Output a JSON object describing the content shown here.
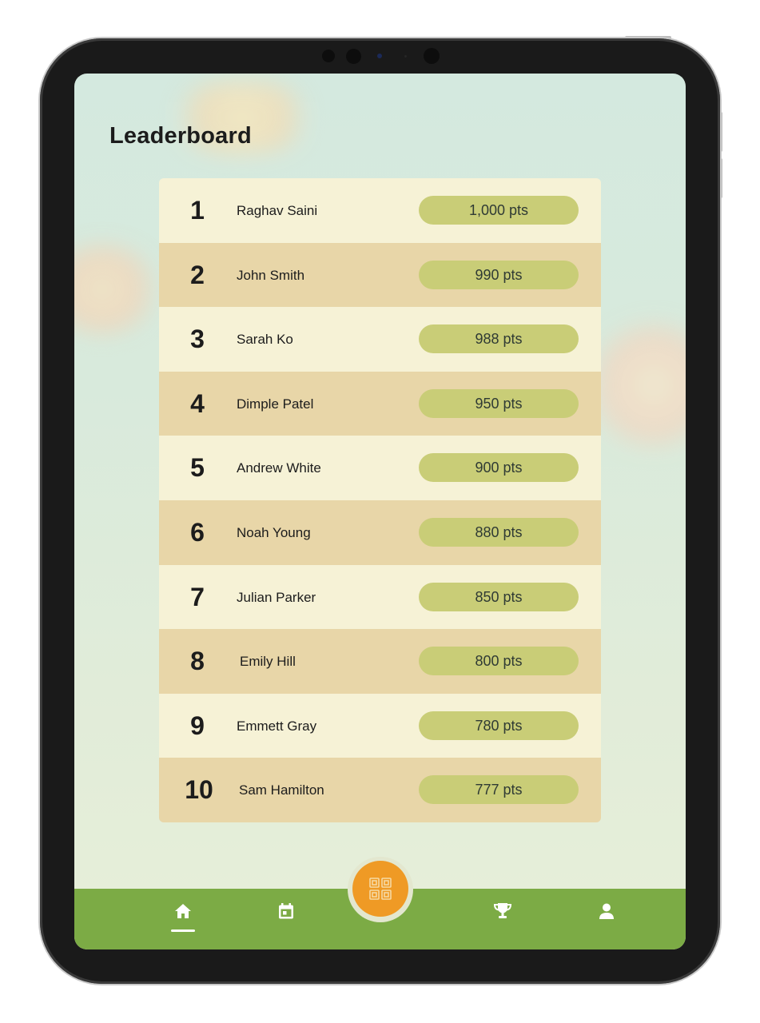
{
  "page": {
    "title": "Leaderboard"
  },
  "leaderboard": [
    {
      "rank": "1",
      "name": "Raghav Saini",
      "points": "1,000 pts"
    },
    {
      "rank": "2",
      "name": "John Smith",
      "points": "990 pts"
    },
    {
      "rank": "3",
      "name": "Sarah Ko",
      "points": "988 pts"
    },
    {
      "rank": "4",
      "name": "Dimple Patel",
      "points": "950 pts"
    },
    {
      "rank": "5",
      "name": "Andrew White",
      "points": "900 pts"
    },
    {
      "rank": "6",
      "name": "Noah Young",
      "points": "880 pts"
    },
    {
      "rank": "7",
      "name": "Julian Parker",
      "points": "850 pts"
    },
    {
      "rank": "8",
      "name": "Emily Hill",
      "points": "800 pts"
    },
    {
      "rank": "9",
      "name": "Emmett Gray",
      "points": "780 pts"
    },
    {
      "rank": "10",
      "name": "Sam Hamilton",
      "points": "777 pts"
    }
  ],
  "navbar": {
    "items": [
      {
        "icon": "home-icon",
        "active": true
      },
      {
        "icon": "calendar-icon",
        "active": false
      },
      {
        "icon": "qr-code-icon",
        "center": true
      },
      {
        "icon": "trophy-icon",
        "active": false
      },
      {
        "icon": "profile-icon",
        "active": false
      }
    ]
  },
  "colors": {
    "row_light": "#f6f2d6",
    "row_dark": "#e8d6a8",
    "points_pill": "#c9cd77",
    "navbar": "#7cab45",
    "fab": "#ef9a25"
  }
}
